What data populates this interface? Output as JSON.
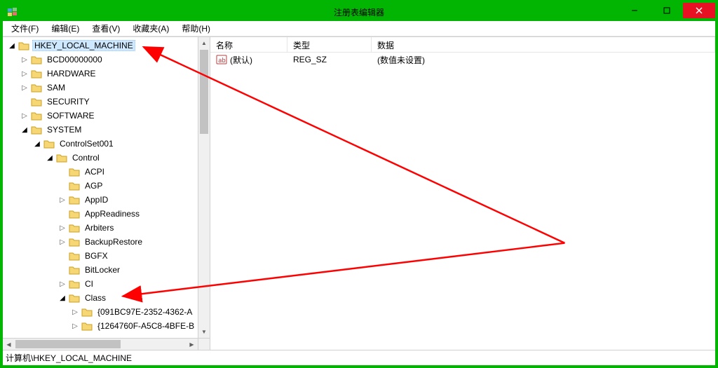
{
  "window": {
    "title": "注册表编辑器"
  },
  "menu": {
    "file": "文件(F)",
    "edit": "编辑(E)",
    "view": "查看(V)",
    "favorites": "收藏夹(A)",
    "help": "帮助(H)"
  },
  "tree": {
    "root_hklm": "HKEY_LOCAL_MACHINE",
    "bcd": "BCD00000000",
    "hardware": "HARDWARE",
    "sam": "SAM",
    "security": "SECURITY",
    "software": "SOFTWARE",
    "system": "SYSTEM",
    "controlset001": "ControlSet001",
    "control": "Control",
    "acpi": "ACPI",
    "agp": "AGP",
    "appid": "AppID",
    "appreadiness": "AppReadiness",
    "arbiters": "Arbiters",
    "backuprestore": "BackupRestore",
    "bgfx": "BGFX",
    "bitlocker": "BitLocker",
    "ci": "CI",
    "class": "Class",
    "guid1": "{091BC97E-2352-4362-A",
    "guid2": "{1264760F-A5C8-4BFE-B"
  },
  "list": {
    "columns": {
      "name": "名称",
      "type": "类型",
      "data": "数据"
    },
    "rows": [
      {
        "name": "(默认)",
        "type": "REG_SZ",
        "data": "(数值未设置)"
      }
    ]
  },
  "statusbar": {
    "path": "计算机\\HKEY_LOCAL_MACHINE"
  }
}
